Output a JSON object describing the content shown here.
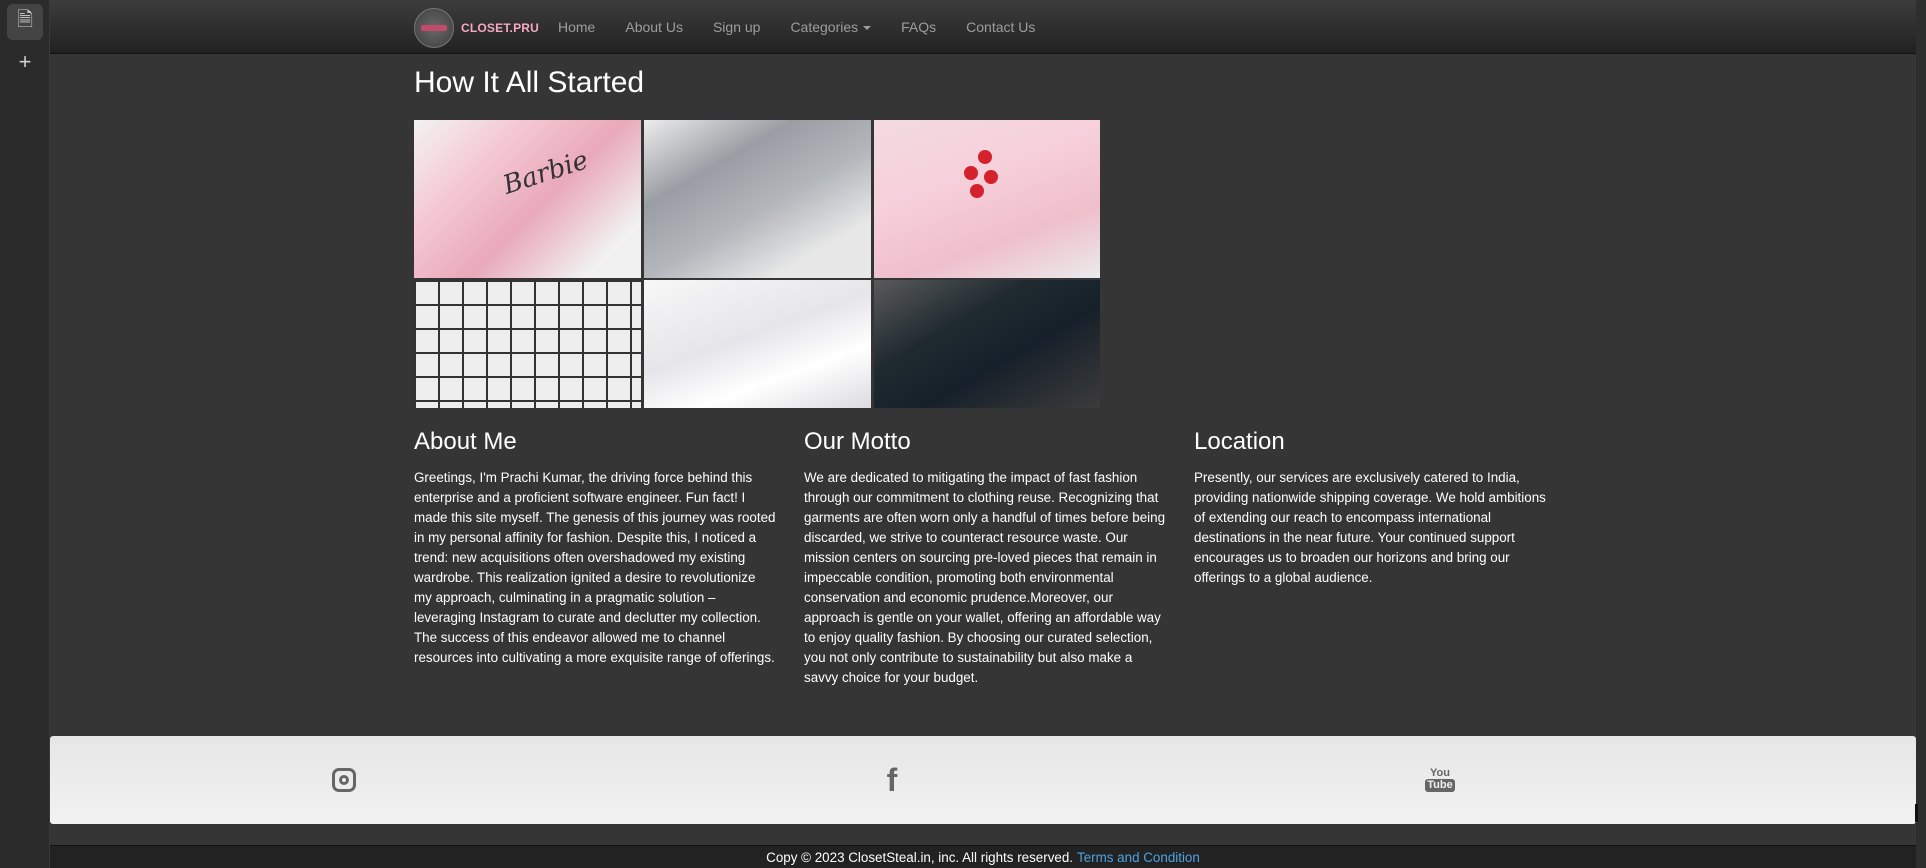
{
  "browser": {
    "rail_icons": [
      "file-icon",
      "plus-icon"
    ]
  },
  "nav": {
    "brand": "CLOSET.PRU",
    "links": [
      "Home",
      "About Us",
      "Sign up",
      "Categories",
      "FAQs",
      "Contact Us"
    ]
  },
  "page": {
    "title": "How It All Started"
  },
  "gallery": {
    "tile1_text": "Barbie"
  },
  "sections": {
    "about": {
      "heading": "About Me",
      "body": "Greetings, I'm Prachi Kumar, the driving force behind this enterprise and a proficient software engineer. Fun fact! I made this site myself. The genesis of this journey was rooted in my personal affinity for fashion. Despite this, I noticed a trend: new acquisitions often overshadowed my existing wardrobe. This realization ignited a desire to revolutionize my approach, culminating in a pragmatic solution – leveraging Instagram to curate and declutter my collection. The success of this endeavor allowed me to channel resources into cultivating a more exquisite range of offerings."
    },
    "motto": {
      "heading": "Our Motto",
      "body": "We are dedicated to mitigating the impact of fast fashion through our commitment to clothing reuse. Recognizing that garments are often worn only a handful of times before being discarded, we strive to counteract resource waste. Our mission centers on sourcing pre-loved pieces that remain in impeccable condition, promoting both environmental conservation and economic prudence.Moreover, our approach is gentle on your wallet, offering an affordable way to enjoy quality fashion. By choosing our curated selection, you not only contribute to sustainability but also make a savvy choice for your budget."
    },
    "location": {
      "heading": "Location",
      "body": "Presently, our services are exclusively catered to India, providing nationwide shipping coverage. We hold ambitions of extending our reach to encompass international destinations in the near future. Your continued support encourages us to broaden our horizons and bring our offerings to a global audience."
    }
  },
  "social": {
    "facebook_glyph": "f",
    "youtube_top": "You",
    "youtube_bottom": "Tube"
  },
  "footer": {
    "copyright": "Copy © 2023 ClosetSteal.in, inc. All rights reserved.",
    "terms_link": "Terms and Condition"
  }
}
